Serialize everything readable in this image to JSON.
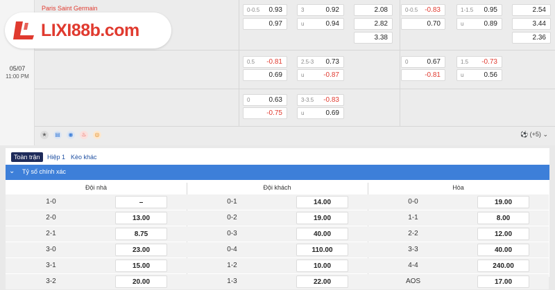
{
  "match": {
    "team": "Paris Saint Germain",
    "date": "05/07",
    "time": "11:00 PM"
  },
  "logo": {
    "text": "LIXI88b.com",
    "icon": "lixi-l-logo-icon"
  },
  "odds_rows": [
    [
      {
        "hc": "0-0.5",
        "od": "0.93",
        "neg": false
      },
      {
        "hc": "3",
        "od": "0.92",
        "neg": false
      },
      {
        "hc": "",
        "od": "2.08",
        "neg": false
      },
      {
        "hc": "0-0.5",
        "od": "-0.83",
        "neg": true
      },
      {
        "hc": "1-1.5",
        "od": "0.95",
        "neg": false
      },
      {
        "hc": "",
        "od": "2.54",
        "neg": false
      }
    ],
    [
      {
        "hc": "",
        "od": "0.97",
        "neg": false
      },
      {
        "hc": "u",
        "od": "0.94",
        "neg": false
      },
      {
        "hc": "",
        "od": "2.82",
        "neg": false
      },
      {
        "hc": "",
        "od": "0.70",
        "neg": false
      },
      {
        "hc": "u",
        "od": "0.89",
        "neg": false
      },
      {
        "hc": "",
        "od": "3.44",
        "neg": false
      }
    ],
    [
      {
        "hc": "",
        "od": "3.38",
        "neg": false
      },
      {
        "hc": "",
        "od": "2.36",
        "neg": false
      }
    ],
    [
      {
        "hc": "0.5",
        "od": "-0.81",
        "neg": true
      },
      {
        "hc": "2.5-3",
        "od": "0.73",
        "neg": false
      },
      {
        "hc": "0",
        "od": "0.67",
        "neg": false
      },
      {
        "hc": "1.5",
        "od": "-0.73",
        "neg": true
      }
    ],
    [
      {
        "hc": "",
        "od": "0.69",
        "neg": false
      },
      {
        "hc": "u",
        "od": "-0.87",
        "neg": true
      },
      {
        "hc": "",
        "od": "-0.81",
        "neg": true
      },
      {
        "hc": "u",
        "od": "0.56",
        "neg": false
      }
    ],
    [
      {
        "hc": "0",
        "od": "0.63",
        "neg": false
      },
      {
        "hc": "3-3.5",
        "od": "-0.83",
        "neg": true
      }
    ],
    [
      {
        "hc": "",
        "od": "-0.75",
        "neg": true
      },
      {
        "hc": "u",
        "od": "0.69",
        "neg": false
      }
    ]
  ],
  "more_markets": "(+5)",
  "tabs": [
    "Toàn trận",
    "Hiệp 1",
    "Kèo khác"
  ],
  "section_title": "Tỷ số chính xác",
  "columns": [
    "Đội nhà",
    "Đội khách",
    "Hòa"
  ],
  "scores": [
    {
      "home": [
        "1-0",
        "–"
      ],
      "away": [
        "0-1",
        "14.00"
      ],
      "draw": [
        "0-0",
        "19.00"
      ]
    },
    {
      "home": [
        "2-0",
        "13.00"
      ],
      "away": [
        "0-2",
        "19.00"
      ],
      "draw": [
        "1-1",
        "8.00"
      ]
    },
    {
      "home": [
        "2-1",
        "8.75"
      ],
      "away": [
        "0-3",
        "40.00"
      ],
      "draw": [
        "2-2",
        "12.00"
      ]
    },
    {
      "home": [
        "3-0",
        "23.00"
      ],
      "away": [
        "0-4",
        "110.00"
      ],
      "draw": [
        "3-3",
        "40.00"
      ]
    },
    {
      "home": [
        "3-1",
        "15.00"
      ],
      "away": [
        "1-2",
        "10.00"
      ],
      "draw": [
        "4-4",
        "240.00"
      ]
    },
    {
      "home": [
        "3-2",
        "20.00"
      ],
      "away": [
        "1-3",
        "22.00"
      ],
      "draw": [
        "AOS",
        "17.00"
      ]
    }
  ],
  "colors": {
    "accent_blue": "#3d7fd9",
    "negative": "#e03a2f",
    "tab_active": "#1e2b5a"
  }
}
